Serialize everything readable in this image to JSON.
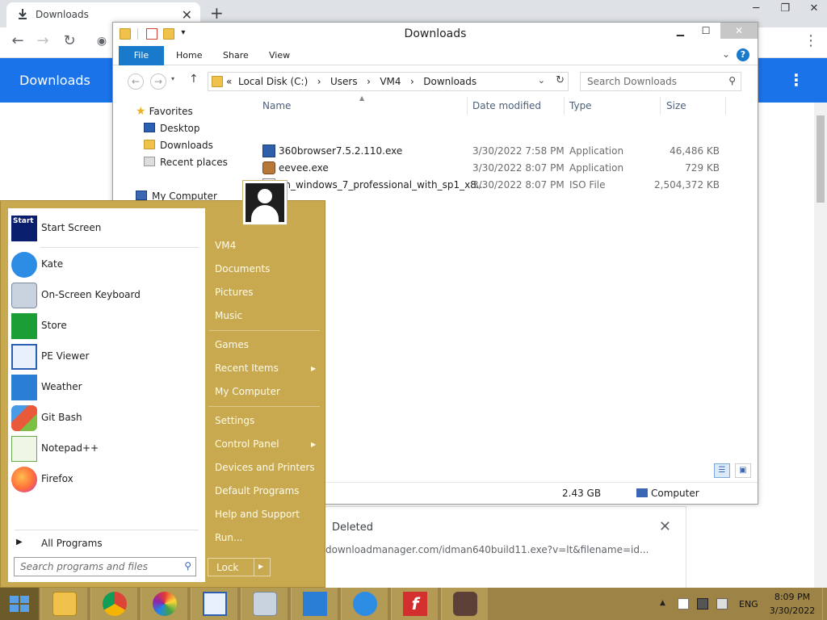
{
  "chrome": {
    "tab_title": "Downloads",
    "tab_close": "✕",
    "new_tab": "+",
    "window_controls": [
      "─",
      "❐",
      "✕"
    ],
    "page_title": "Downloads",
    "menu_icon": "⋮",
    "download": {
      "status": "Deleted",
      "url": "downloadmanager.com/idman640build11.exe?v=lt&filename=id...",
      "close": "✕"
    }
  },
  "explorer": {
    "title": "Downloads",
    "ribbon_tabs": [
      "File",
      "Home",
      "Share",
      "View"
    ],
    "breadcrumb": [
      "«",
      "Local Disk (C:)",
      "›",
      "Users",
      "›",
      "VM4",
      "›",
      "Downloads"
    ],
    "search_placeholder": "Search Downloads",
    "nav": {
      "favorites": "Favorites",
      "desktop": "Desktop",
      "downloads": "Downloads",
      "recent": "Recent places",
      "computer": "My Computer"
    },
    "columns": [
      "Name",
      "Date modified",
      "Type",
      "Size"
    ],
    "files": [
      {
        "name": "360browser7.5.2.110.exe",
        "date": "3/30/2022 7:58 PM",
        "type": "Application",
        "size": "46,486 KB"
      },
      {
        "name": "eevee.exe",
        "date": "3/30/2022 8:07 PM",
        "type": "Application",
        "size": "729 KB"
      },
      {
        "name": "en_windows_7_professional_with_sp1_x8...",
        "date": "3/30/2022 8:07 PM",
        "type": "ISO File",
        "size": "2,504,372 KB"
      }
    ],
    "status": {
      "free_space": "2.43 GB",
      "location": "Computer"
    }
  },
  "start_menu": {
    "pinned": [
      {
        "label": "Start Screen",
        "icon": "start-screen-icon"
      },
      {
        "label": "Kate",
        "icon": "kate-icon"
      },
      {
        "label": "On-Screen Keyboard",
        "icon": "keyboard-icon"
      },
      {
        "label": "Store",
        "icon": "store-icon"
      },
      {
        "label": "PE Viewer",
        "icon": "pe-viewer-icon"
      },
      {
        "label": "Weather",
        "icon": "weather-icon"
      },
      {
        "label": "Git Bash",
        "icon": "git-bash-icon"
      },
      {
        "label": "Notepad++",
        "icon": "notepad-plus-plus-icon"
      },
      {
        "label": "Firefox",
        "icon": "firefox-icon"
      }
    ],
    "start_tile_text": "Start",
    "all_programs": "All Programs",
    "search_placeholder": "Search programs and files",
    "right_items": [
      "VM4",
      "Documents",
      "Pictures",
      "Music",
      "Games",
      "Recent Items",
      "My Computer",
      "Settings",
      "Control Panel",
      "Devices and Printers",
      "Default Programs",
      "Help and Support",
      "Run..."
    ],
    "lock": "Lock"
  },
  "taskbar": {
    "apps": [
      "file-explorer-icon",
      "chrome-icon",
      "color-picker-icon",
      "pe-viewer-icon",
      "keyboard-icon",
      "weather-icon",
      "kate-icon",
      "flash-icon",
      "recycle-app-icon"
    ],
    "language": "ENG",
    "time": "8:09 PM",
    "date": "3/30/2022"
  },
  "colors": {
    "start_gold": "#c8a950",
    "taskbar": "#9d8446",
    "chrome_blue": "#1a73e8",
    "ribbon_blue": "#1979ca"
  }
}
